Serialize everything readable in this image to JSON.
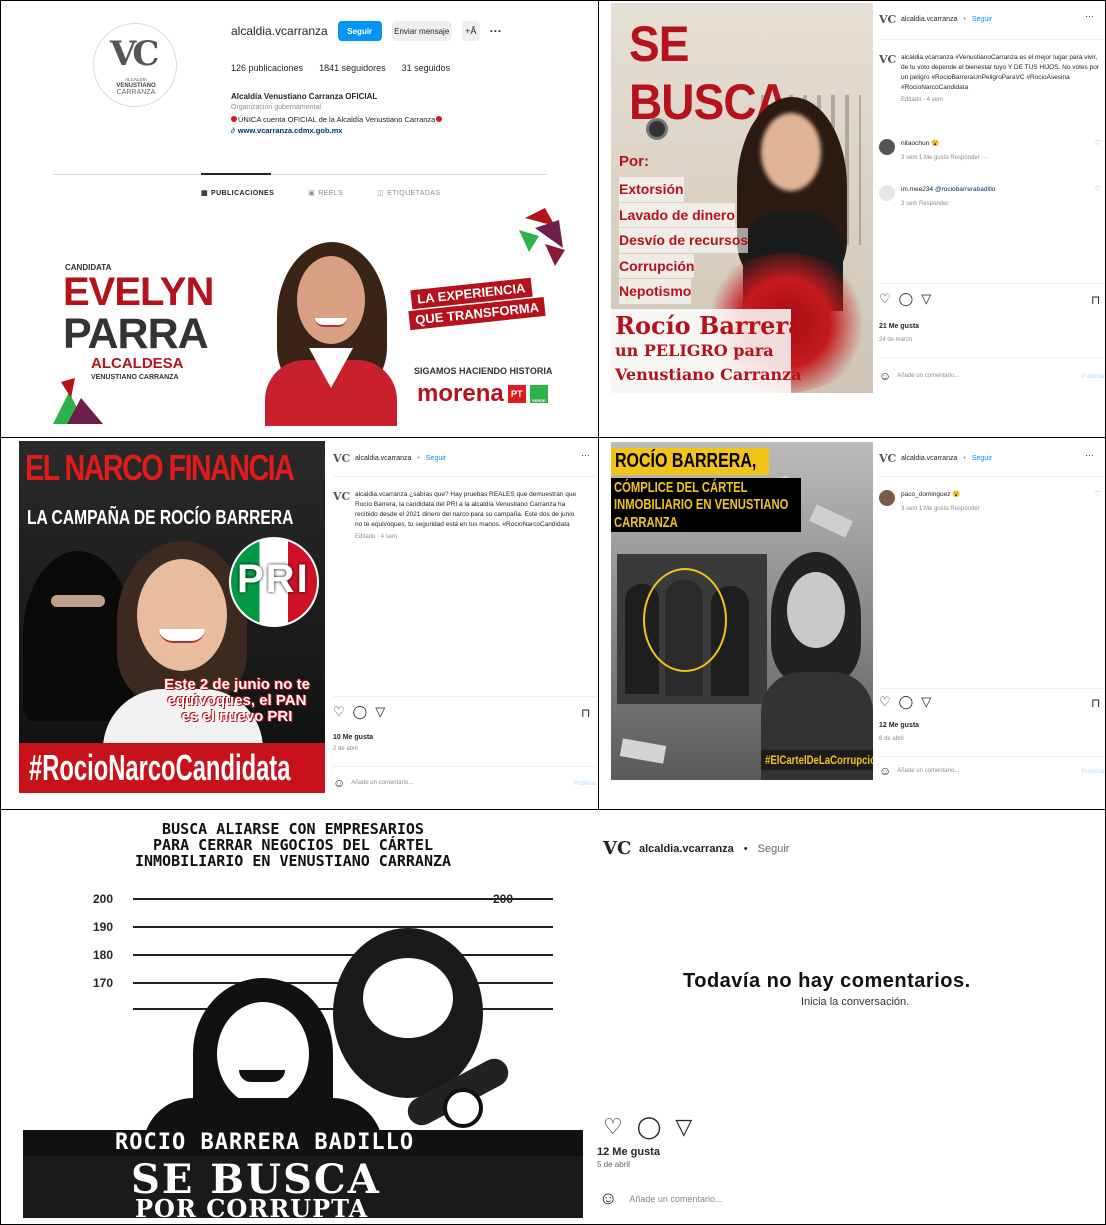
{
  "profile": {
    "username": "alcaldia.vcarranza",
    "follow_label": "Seguir",
    "message_label": "Enviar mensaje",
    "posts": "126 publicaciones",
    "followers": "1841 seguidores",
    "following": "31 seguidos",
    "name": "Alcaldía Venustiano Carranza OFICIAL",
    "category": "Organización gubernamental",
    "bio": "ÚNICA cuenta OFICIAL de la Alcaldía Venustiano Carranza",
    "link": "www.vcarranza.cdmx.gob.mx",
    "logo_lines": [
      "ALCALDÍA",
      "VENUSTIANO",
      "CARRANZA"
    ],
    "tabs": [
      "PUBLICACIONES",
      "REELS",
      "ETIQUETADAS"
    ],
    "banner": {
      "candidata": "CANDIDATA",
      "name1": "EVELYN",
      "name2": "PARRA",
      "role": "ALCALDESA",
      "place": "VENUSTIANO CARRANZA",
      "slogan1": "LA EXPERIENCIA",
      "slogan2": "QUE TRANSFORMA",
      "historia": "SIGAMOS HACIENDO HISTORIA",
      "party": "morena",
      "pt": "PT",
      "verde": "VERDE"
    }
  },
  "post1": {
    "user": "alcaldia.vcarranza",
    "follow": "Seguir",
    "image": {
      "title": "SE BUSCA",
      "por": "Por:",
      "crimes": [
        "Extorsión",
        "Lavado de dinero",
        "Desvío de recursos",
        "Corrupción",
        "Nepotismo"
      ],
      "bottom1": "Rocío Barrera",
      "bottom2": "un PELIGRO para",
      "bottom3": "Venustiano Carranza"
    },
    "caption_user": "alcaldia.vcarranza",
    "caption": "#VenustianoCarranza es el mejor lugar para vivir, de tu voto depende el bienestar tuyo Y DE TUS HIJOS. No votes por un peligro #RocioBarreraUnPeligroParaVC #RocioAsesina #RocioNarcoCandidata",
    "caption_meta": "Editado · 4 sem",
    "comments": [
      {
        "user": "nitaochun",
        "text": "😮",
        "meta": "3 sem   1 Me gusta   Responder   ···"
      },
      {
        "user": "im.mee234",
        "text": "@rociobarrerabadillo",
        "meta": "3 sem   Responder"
      }
    ],
    "likes": "21 Me gusta",
    "date": "24 de marzo",
    "add_comment": "Añade un comentario...",
    "publish": "Publicar"
  },
  "post2": {
    "user": "alcaldia.vcarranza",
    "follow": "Seguir",
    "image": {
      "title": "EL NARCO FINANCIA",
      "subtitle": "LA CAMPAÑA DE ROCÍO BARRERA",
      "pri": "PRI",
      "note1": "Este 2 de junio no te",
      "note2": "equivoques, el PAN",
      "note3": "es el nuevo PRI",
      "hashtag": "#RocioNarcoCandidata"
    },
    "caption_user": "alcaldia.vcarranza",
    "caption": "¿sabías que? Hay pruebas REALES que demuestran que Rocío Barrera, la candidata del PRI a la alcaldía Venustiano Carranza ha recibido desde el 2021 dinero del narco para su campaña. Este dos de junio no te equivoques, tu seguridad está en tus manos. #RocioNarcoCandidata",
    "caption_meta": "Editado · 4 sem",
    "likes": "10 Me gusta",
    "date": "2 de abril",
    "add_comment": "Añade un comentario...",
    "publish": "Publicar"
  },
  "post3": {
    "user": "alcaldia.vcarranza",
    "follow": "Seguir",
    "image": {
      "title1": "ROCÍO BARRERA,",
      "title2": "CÓMPLICE DEL CÁRTEL",
      "title3": "INMOBILIARIO EN VENUSTIANO",
      "title4": "CARRANZA",
      "hashtag": "#ElCartelDeLaCorrupción"
    },
    "comments": [
      {
        "user": "paco_dominguez",
        "text": "😮",
        "meta": "3 sem   1 Me gusta   Responder"
      }
    ],
    "likes": "12 Me gusta",
    "date": "6 de abril",
    "add_comment": "Añade un comentario...",
    "publish": "Publicar"
  },
  "post4": {
    "user": "alcaldia.vcarranza",
    "follow": "Seguir",
    "image": {
      "top1": "BUSCA ALIARSE CON EMPRESARIOS",
      "top2": "PARA CERRAR NEGOCIOS DEL CÁRTEL",
      "top3": "INMOBILIARIO EN VENUSTIANO CARRANZA",
      "heights": [
        "200",
        "190",
        "180",
        "170"
      ],
      "height_right": "200",
      "name": "ROCIO BARRERA BADILLO",
      "wanted": "SE BUSCA",
      "reason": "POR CORRUPTA"
    },
    "no_comments": "Todavía no hay comentarios.",
    "start": "Inicia la conversación.",
    "likes": "12 Me gusta",
    "date": "5 de abril",
    "add_comment": "Añade un comentario..."
  },
  "colors": {
    "instagram_blue": "#0095f6",
    "morena_red": "#b5121b",
    "pri_green": "#009a44",
    "pri_red": "#ce1126",
    "narco_red": "#e11b1b",
    "yellow": "#f2c418"
  }
}
